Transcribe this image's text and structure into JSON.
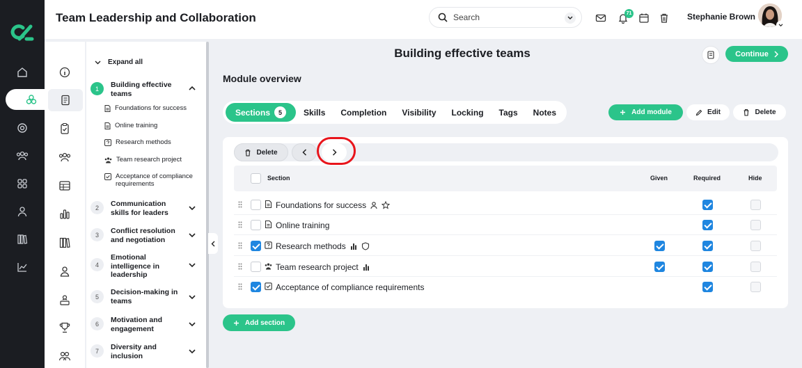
{
  "header": {
    "title": "Team Leadership and Collaboration",
    "search_placeholder": "Search",
    "notification_count": "71",
    "user_name": "Stephanie Brown"
  },
  "rail": {
    "icons": [
      "home-icon",
      "modules-icon",
      "target-icon",
      "team-icon",
      "grid-icon",
      "user-icon",
      "library-icon",
      "analytics-icon"
    ],
    "active": "modules-icon"
  },
  "iconcol": {
    "icons": [
      "info-icon",
      "book-icon",
      "clipboard-check-icon",
      "people-icon",
      "table-icon",
      "bar-chart-icon",
      "library-icon",
      "person-icon",
      "certificate-icon",
      "trophy-icon",
      "group-icon"
    ],
    "active": "book-icon"
  },
  "tree": {
    "expand_all": "Expand all",
    "sections": [
      {
        "num": "1",
        "label": "Building effective teams",
        "expanded": true,
        "items": [
          "Foundations for success",
          "Online training",
          "Research methods",
          "Team research project",
          "Acceptance of compliance requirements"
        ]
      },
      {
        "num": "2",
        "label": "Communication skills for leaders"
      },
      {
        "num": "3",
        "label": "Conflict resolution and negotiation"
      },
      {
        "num": "4",
        "label": "Emotional intelligence in leadership"
      },
      {
        "num": "5",
        "label": "Decision-making in teams"
      },
      {
        "num": "6",
        "label": "Motivation and engagement"
      },
      {
        "num": "7",
        "label": "Diversity and inclusion"
      }
    ]
  },
  "main": {
    "module_title": "Building effective teams",
    "continue_label": "Continue",
    "overview_title": "Module overview",
    "tabs": [
      {
        "label": "Sections",
        "count": "5",
        "active": true
      },
      {
        "label": "Skills"
      },
      {
        "label": "Completion"
      },
      {
        "label": "Visibility"
      },
      {
        "label": "Locking"
      },
      {
        "label": "Tags"
      },
      {
        "label": "Notes"
      }
    ],
    "add_module_label": "Add module",
    "edit_label": "Edit",
    "delete_label": "Delete",
    "toolbar_delete_label": "Delete",
    "table": {
      "columns": [
        "Section",
        "Given",
        "Required",
        "Hide"
      ],
      "rows": [
        {
          "label": "Foundations for success",
          "type": "document",
          "extra_icons": [
            "person-icon",
            "star-icon"
          ],
          "selected": false,
          "given": null,
          "required": true,
          "hide": false
        },
        {
          "label": "Online training",
          "type": "document",
          "extra_icons": [],
          "selected": false,
          "given": null,
          "required": true,
          "hide": false
        },
        {
          "label": "Research methods",
          "type": "quiz",
          "extra_icons": [
            "bar-chart-icon",
            "shield-icon"
          ],
          "selected": true,
          "given": true,
          "required": true,
          "hide": false
        },
        {
          "label": "Team research project",
          "type": "group",
          "extra_icons": [
            "bar-chart-icon"
          ],
          "selected": false,
          "given": true,
          "required": true,
          "hide": false
        },
        {
          "label": "Acceptance of compliance requirements",
          "type": "checkbox",
          "extra_icons": [],
          "selected": true,
          "given": null,
          "required": true,
          "hide": false
        }
      ]
    },
    "add_section_label": "Add section"
  },
  "colors": {
    "accent": "#2bc48a",
    "checkbox": "#1f86e0",
    "highlight": "#e8141b",
    "rail": "#1b1d22"
  }
}
